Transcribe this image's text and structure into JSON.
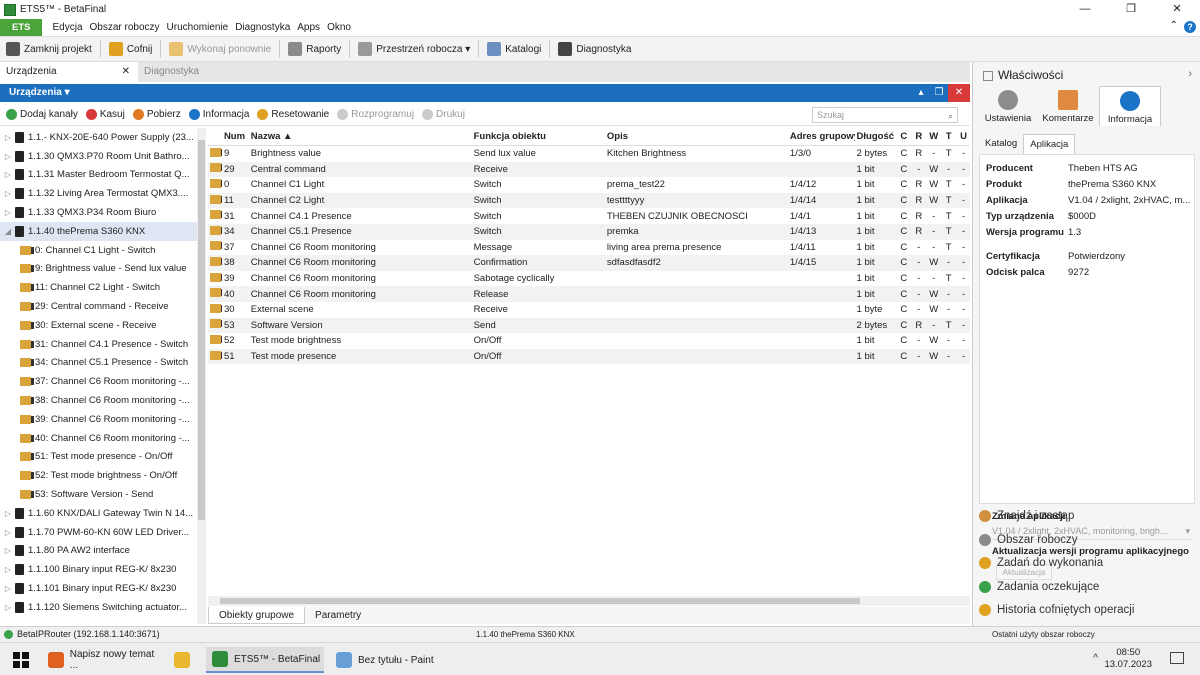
{
  "window": {
    "title": "ETS5™ - BetaFinal",
    "min": "—",
    "max": "❐",
    "close": "✕"
  },
  "menu": {
    "ets": "ETS",
    "items": [
      "Edycja",
      "Obszar roboczy",
      "Uruchomienie",
      "Diagnostyka",
      "Apps",
      "Okno"
    ],
    "collapse": "⌃",
    "help": "?"
  },
  "toolbar": {
    "items": [
      {
        "label": "Zamknij projekt",
        "icon": "close-project-icon",
        "color": "#555555",
        "disabled": false
      },
      {
        "label": "Cofnij",
        "icon": "undo-icon",
        "color": "#e0a020",
        "disabled": false
      },
      {
        "label": "Wykonaj ponownie",
        "icon": "redo-icon",
        "color": "#e8c070",
        "disabled": true
      },
      {
        "label": "Raporty",
        "icon": "printer-icon",
        "color": "#8a8a8a",
        "disabled": false
      },
      {
        "label": "Przestrzeń robocza ▾",
        "icon": "workspace-icon",
        "color": "#999999",
        "disabled": false
      },
      {
        "label": "Katalogi",
        "icon": "catalog-icon",
        "color": "#6a8fc0",
        "disabled": false
      },
      {
        "label": "Diagnostyka",
        "icon": "diagnostics-icon",
        "color": "#444444",
        "disabled": false
      }
    ]
  },
  "doctabs": [
    {
      "label": "Urządzenia",
      "close": "✕"
    },
    {
      "label": "Diagnostyka"
    }
  ],
  "panel": {
    "title": "Urządzenia ▾",
    "ctl_up": "▴",
    "ctl_restore": "❐",
    "ctl_close": "✕"
  },
  "subtoolbar": {
    "items": [
      {
        "label": "Dodaj kanały",
        "icon": "add-icon",
        "color": "#3aa04a",
        "disabled": false
      },
      {
        "label": "Kasuj",
        "icon": "delete-icon",
        "color": "#d83a3a",
        "disabled": false
      },
      {
        "label": "Pobierz",
        "icon": "download-icon",
        "color": "#e07a20",
        "disabled": false
      },
      {
        "label": "Informacja",
        "icon": "info-icon",
        "color": "#1a73c6",
        "disabled": false
      },
      {
        "label": "Resetowanie",
        "icon": "reset-icon",
        "color": "#e0a020",
        "disabled": false
      },
      {
        "label": "Rozprogramuj",
        "icon": "unload-icon",
        "color": "#cccccc",
        "disabled": true
      },
      {
        "label": "Drukuj",
        "icon": "print-icon",
        "color": "#cccccc",
        "disabled": true
      }
    ],
    "search_placeholder": "Szukaj"
  },
  "tree": [
    {
      "label": "1.1.- KNX-20E-640 Power Supply (23...",
      "type": "device",
      "expand": "▷"
    },
    {
      "label": "1.1.30 QMX3.P70 Room Unit Bathro...",
      "type": "device",
      "expand": "▷"
    },
    {
      "label": "1.1.31 Master Bedroom Termostat Q...",
      "type": "device",
      "expand": "▷"
    },
    {
      "label": "1.1.32 Living Area Termostat QMX3....",
      "type": "device",
      "expand": "▷"
    },
    {
      "label": "1.1.33 QMX3.P34 Room Biuro",
      "type": "device",
      "expand": "▷"
    },
    {
      "label": "1.1.40 thePrema S360 KNX",
      "type": "device",
      "expand": "◢",
      "selected": true
    },
    {
      "label": "0: Channel C1 Light - Switch",
      "type": "co"
    },
    {
      "label": "9: Brightness value - Send lux value",
      "type": "co"
    },
    {
      "label": "11: Channel C2 Light - Switch",
      "type": "co"
    },
    {
      "label": "29: Central command - Receive",
      "type": "co"
    },
    {
      "label": "30: External scene - Receive",
      "type": "co"
    },
    {
      "label": "31: Channel C4.1 Presence - Switch",
      "type": "co"
    },
    {
      "label": "34: Channel C5.1 Presence - Switch",
      "type": "co"
    },
    {
      "label": "37: Channel C6 Room monitoring -...",
      "type": "co"
    },
    {
      "label": "38: Channel C6 Room monitoring -...",
      "type": "co"
    },
    {
      "label": "39: Channel C6 Room monitoring -...",
      "type": "co"
    },
    {
      "label": "40: Channel C6 Room monitoring -...",
      "type": "co"
    },
    {
      "label": "51: Test mode presence - On/Off",
      "type": "co"
    },
    {
      "label": "52: Test mode brightness - On/Off",
      "type": "co"
    },
    {
      "label": "53: Software Version - Send",
      "type": "co"
    },
    {
      "label": "1.1.60 KNX/DALI Gateway Twin N 14...",
      "type": "device",
      "expand": "▷"
    },
    {
      "label": "1.1.70 PWM-60-KN 60W LED Driver...",
      "type": "device",
      "expand": "▷"
    },
    {
      "label": "1.1.80 PA AW2 interface",
      "type": "device",
      "expand": "▷"
    },
    {
      "label": "1.1.100 Binary input REG-K/ 8x230",
      "type": "device",
      "expand": "▷"
    },
    {
      "label": "1.1.101 Binary input REG-K/ 8x230",
      "type": "device",
      "expand": "▷"
    },
    {
      "label": "1.1.120 Siemens Switching actuator...",
      "type": "device",
      "expand": "▷"
    }
  ],
  "grid": {
    "headers": {
      "num": "Num",
      "name": "Nazwa ▲",
      "func": "Funkcja obiektu",
      "desc": "Opis",
      "addr": "Adres grupowy",
      "len": "Długość",
      "c": "C",
      "r": "R",
      "w": "W",
      "t": "T",
      "u": "U"
    },
    "rows": [
      {
        "num": "9",
        "name": "Brightness value",
        "func": "Send lux value",
        "desc": "Kitchen Brightness",
        "addr": "1/3/0",
        "len": "2 bytes",
        "c": "C",
        "r": "R",
        "w": "-",
        "t": "T",
        "u": "-"
      },
      {
        "num": "29",
        "name": "Central command",
        "func": "Receive",
        "desc": "",
        "addr": "",
        "len": "1 bit",
        "c": "C",
        "r": "-",
        "w": "W",
        "t": "-",
        "u": "-"
      },
      {
        "num": "0",
        "name": "Channel C1 Light",
        "func": "Switch",
        "desc": "prema_test22",
        "addr": "1/4/12",
        "len": "1 bit",
        "c": "C",
        "r": "R",
        "w": "W",
        "t": "T",
        "u": "-"
      },
      {
        "num": "11",
        "name": "Channel C2 Light",
        "func": "Switch",
        "desc": "testtttyyy",
        "addr": "1/4/14",
        "len": "1 bit",
        "c": "C",
        "r": "R",
        "w": "W",
        "t": "T",
        "u": "-"
      },
      {
        "num": "31",
        "name": "Channel C4.1 Presence",
        "func": "Switch",
        "desc": "THEBEN CZUJNIK OBECNOSCI",
        "addr": "1/4/1",
        "len": "1 bit",
        "c": "C",
        "r": "R",
        "w": "-",
        "t": "T",
        "u": "-"
      },
      {
        "num": "34",
        "name": "Channel C5.1 Presence",
        "func": "Switch",
        "desc": "premka",
        "addr": "1/4/13",
        "len": "1 bit",
        "c": "C",
        "r": "R",
        "w": "-",
        "t": "T",
        "u": "-"
      },
      {
        "num": "37",
        "name": "Channel C6 Room monitoring",
        "func": "Message",
        "desc": "living area prema presence",
        "addr": "1/4/11",
        "len": "1 bit",
        "c": "C",
        "r": "-",
        "w": "-",
        "t": "T",
        "u": "-"
      },
      {
        "num": "38",
        "name": "Channel C6 Room monitoring",
        "func": "Confirmation",
        "desc": "sdfasdfasdf2",
        "addr": "1/4/15",
        "len": "1 bit",
        "c": "C",
        "r": "-",
        "w": "W",
        "t": "-",
        "u": "-"
      },
      {
        "num": "39",
        "name": "Channel C6 Room monitoring",
        "func": "Sabotage cyclically",
        "desc": "",
        "addr": "",
        "len": "1 bit",
        "c": "C",
        "r": "-",
        "w": "-",
        "t": "T",
        "u": "-"
      },
      {
        "num": "40",
        "name": "Channel C6 Room monitoring",
        "func": "Release",
        "desc": "",
        "addr": "",
        "len": "1 bit",
        "c": "C",
        "r": "-",
        "w": "W",
        "t": "-",
        "u": "-"
      },
      {
        "num": "30",
        "name": "External scene",
        "func": "Receive",
        "desc": "",
        "addr": "",
        "len": "1 byte",
        "c": "C",
        "r": "-",
        "w": "W",
        "t": "-",
        "u": "-"
      },
      {
        "num": "53",
        "name": "Software Version",
        "func": "Send",
        "desc": "",
        "addr": "",
        "len": "2 bytes",
        "c": "C",
        "r": "R",
        "w": "-",
        "t": "T",
        "u": "-"
      },
      {
        "num": "52",
        "name": "Test mode brightness",
        "func": "On/Off",
        "desc": "",
        "addr": "",
        "len": "1 bit",
        "c": "C",
        "r": "-",
        "w": "W",
        "t": "-",
        "u": "-"
      },
      {
        "num": "51",
        "name": "Test mode presence",
        "func": "On/Off",
        "desc": "",
        "addr": "",
        "len": "1 bit",
        "c": "C",
        "r": "-",
        "w": "W",
        "t": "-",
        "u": "-"
      }
    ]
  },
  "bottomtabs": [
    "Obiekty grupowe",
    "Parametry"
  ],
  "status": {
    "connection": "BetaIPRouter (192.168.1.140:3671)",
    "selected": "1.1.40 thePrema S360 KNX",
    "workspace": "Ostatni użyty obszar roboczy"
  },
  "properties": {
    "title": "Właściwości",
    "chevron": "›",
    "tabs": [
      {
        "label": "Ustawienia",
        "color": "#8c8c8c"
      },
      {
        "label": "Komentarze",
        "color": "#e08a40"
      },
      {
        "label": "Informacja",
        "color": "#1a73c6"
      }
    ],
    "subtabs": [
      "Katalog",
      "Aplikacja"
    ],
    "fields": [
      {
        "k": "Producent",
        "v": "Theben HTS AG"
      },
      {
        "k": "Produkt",
        "v": "thePrema S360 KNX"
      },
      {
        "k": "Aplikacja",
        "v": "V1.04 / 2xlight, 2xHVAC, m..."
      },
      {
        "k": "Typ urządzenia",
        "v": "$000D"
      },
      {
        "k": "Wersja programu",
        "v": "1.3"
      },
      {
        "k": "Certyfikacja",
        "v": "Potwierdzony"
      },
      {
        "k": "Odcisk palca",
        "v": "9272"
      }
    ],
    "zmiana_label": "Zmiana aplikacji",
    "zmiana_value": "V1.04 / 2xlight, 2xHVAC, monitoring, brigh...",
    "zmiana_arrow": "▾",
    "aktual_label": "Aktualizacja wersji programu aplikacyjnego",
    "aktual_button": "Aktualizacja",
    "links": [
      {
        "label": "Znajdź i zastąp",
        "color": "#d09040"
      },
      {
        "label": "Obszar roboczy",
        "color": "#8a8a8a"
      },
      {
        "label": "Zadań do wykonania",
        "color": "#e0a020"
      },
      {
        "label": "Zadania oczekujące",
        "color": "#3aa04a"
      },
      {
        "label": "Historia cofniętych operacji",
        "color": "#e0a020"
      }
    ]
  },
  "taskbar": {
    "items": [
      {
        "label": "Napisz nowy temat ...",
        "color": "#e06020"
      },
      {
        "label": "",
        "color": "#e8b830"
      },
      {
        "label": "ETS5™ - BetaFinal",
        "color": "#2e8b3a",
        "active": true
      },
      {
        "label": "Bez tytułu - Paint",
        "color": "#6aa0d8"
      }
    ],
    "tray": "^",
    "time": "08:50",
    "date": "13.07.2023"
  }
}
